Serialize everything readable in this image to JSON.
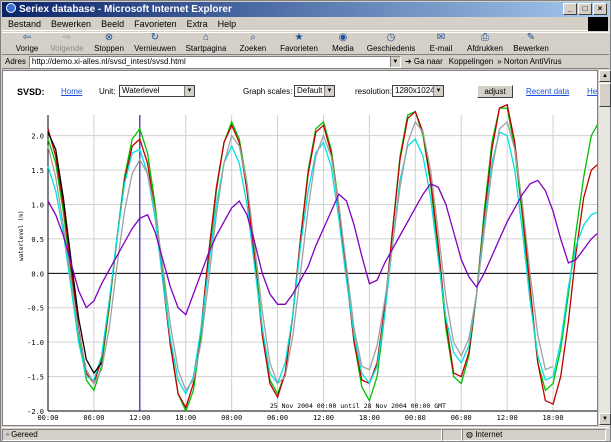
{
  "window": {
    "title": "Seriex database - Microsoft Internet Explorer"
  },
  "menubar": {
    "items": [
      "Bestand",
      "Bewerken",
      "Beeld",
      "Favorieten",
      "Extra",
      "Help"
    ]
  },
  "toolbar": {
    "buttons": [
      {
        "label": "Vorige",
        "icon": "back-arrow-icon",
        "enabled": true
      },
      {
        "label": "Volgende",
        "icon": "forward-arrow-icon",
        "enabled": false
      },
      {
        "label": "Stoppen",
        "icon": "stop-icon",
        "enabled": true
      },
      {
        "label": "Vernieuwen",
        "icon": "refresh-icon",
        "enabled": true
      },
      {
        "label": "Startpagina",
        "icon": "home-icon",
        "enabled": true
      },
      {
        "label": "Zoeken",
        "icon": "search-icon",
        "enabled": true
      },
      {
        "label": "Favorieten",
        "icon": "favorites-icon",
        "enabled": true
      },
      {
        "label": "Media",
        "icon": "media-icon",
        "enabled": true
      },
      {
        "label": "Geschiedenis",
        "icon": "history-icon",
        "enabled": true
      },
      {
        "label": "E-mail",
        "icon": "mail-icon",
        "enabled": true
      },
      {
        "label": "Afdrukken",
        "icon": "print-icon",
        "enabled": true
      },
      {
        "label": "Bewerken",
        "icon": "edit-icon",
        "enabled": true
      }
    ]
  },
  "address": {
    "label": "Adres",
    "url": "http://demo.xi-alles.nl/svsd_intest/svsd.html",
    "go_label": "Ga naar",
    "links_label": "Koppelingen",
    "extra_label": "Norton AntiVirus"
  },
  "page": {
    "svsd_label": "SVSD:",
    "home_link": "Home",
    "unit_label": "Unit:",
    "unit_value": "Waterlevel",
    "graph_scales_label": "Graph scales:",
    "graph_scales_value": "Default",
    "resolution_label": "resolution:",
    "resolution_value": "1280x1024",
    "adjust_button": "adjust",
    "recent_data_link": "Recent data",
    "help_link": "Help"
  },
  "statusbar": {
    "status_text": "Gereed",
    "zone_text": "Internet"
  },
  "chart_data": {
    "type": "line",
    "title": "",
    "ylabel": "waterlevel (m)",
    "xlabel": "",
    "annotation": "25 Nov 2004 00:00 until 28 Nov 2004 00:00 GMT",
    "ylim": [
      -2.0,
      2.3
    ],
    "yticks": [
      -2.0,
      -1.5,
      -1.0,
      -0.5,
      0.0,
      0.5,
      1.0,
      1.5,
      2.0
    ],
    "ytick_labels": [
      "-2.0",
      "-1.5",
      "-1.0",
      "-0.5",
      "0.0",
      "0.5",
      "1.0",
      "1.5",
      "2.0"
    ],
    "xlim_hours": [
      0,
      72
    ],
    "xticks_hours": [
      0,
      6,
      12,
      18,
      24,
      30,
      36,
      42,
      48,
      54,
      60,
      66
    ],
    "xtick_labels": [
      "00:00",
      "06:00",
      "12:00",
      "18:00",
      "00:00",
      "06:00",
      "12:00",
      "18:00",
      "00:00",
      "06:00",
      "12:00",
      "18:00"
    ],
    "marker_hour": 12,
    "grid": true,
    "series": [
      {
        "color": "#00c000",
        "x": [
          0,
          1,
          2,
          3,
          4,
          5,
          6,
          7,
          8,
          9,
          10,
          11,
          12,
          13,
          14,
          15,
          16,
          17,
          18,
          19,
          20,
          21,
          22,
          23,
          24,
          25,
          26,
          27,
          28,
          29,
          30,
          31,
          32,
          33,
          34,
          35,
          36,
          37,
          38,
          39,
          40,
          41,
          42,
          43,
          44,
          45,
          46,
          47,
          48,
          49,
          50,
          51,
          52,
          53,
          54,
          55,
          56,
          57,
          58,
          59,
          60,
          61,
          62,
          63,
          64,
          65,
          66,
          67,
          68,
          69,
          70,
          71,
          72
        ],
        "y": [
          1.95,
          1.6,
          0.9,
          0.0,
          -0.9,
          -1.55,
          -1.7,
          -1.35,
          -0.5,
          0.5,
          1.4,
          1.95,
          2.1,
          1.75,
          1.0,
          0.0,
          -1.0,
          -1.75,
          -2.0,
          -1.7,
          -0.9,
          0.2,
          1.2,
          1.9,
          2.2,
          1.95,
          1.3,
          0.3,
          -0.8,
          -1.55,
          -1.75,
          -1.45,
          -0.6,
          0.5,
          1.5,
          2.1,
          2.2,
          1.8,
          1.0,
          0.0,
          -1.0,
          -1.65,
          -1.85,
          -1.5,
          -0.6,
          0.6,
          1.7,
          2.3,
          2.35,
          2.0,
          1.3,
          0.3,
          -0.8,
          -1.5,
          -1.6,
          -1.2,
          -0.3,
          0.9,
          1.9,
          2.4,
          2.4,
          1.8,
          0.8,
          -0.3,
          -1.3,
          -1.7,
          -1.6,
          -1.1,
          -0.3,
          0.6,
          1.4,
          2.0,
          2.2
        ]
      },
      {
        "color": "#c00000",
        "x": [
          0,
          1,
          2,
          3,
          4,
          5,
          6,
          7,
          8,
          9,
          10,
          11,
          12,
          13,
          14,
          15,
          16,
          17,
          18,
          19,
          20,
          21,
          22,
          23,
          24,
          25,
          26,
          27,
          28,
          29,
          30,
          31,
          32,
          33,
          34,
          35,
          36,
          37,
          38,
          39,
          40,
          41,
          42,
          43,
          44,
          45,
          46,
          47,
          48,
          49,
          50,
          51,
          52,
          53,
          54,
          55,
          56,
          57,
          58,
          59,
          60,
          61,
          62,
          63,
          64,
          65,
          66,
          67,
          68,
          69,
          70,
          71,
          72
        ],
        "y": [
          2.1,
          1.7,
          1.0,
          0.1,
          -0.8,
          -1.45,
          -1.6,
          -1.25,
          -0.45,
          0.5,
          1.35,
          1.85,
          1.95,
          1.6,
          0.9,
          -0.1,
          -1.05,
          -1.75,
          -1.95,
          -1.6,
          -0.8,
          0.3,
          1.25,
          1.9,
          2.15,
          1.9,
          1.2,
          0.2,
          -0.9,
          -1.6,
          -1.8,
          -1.45,
          -0.6,
          0.5,
          1.45,
          2.05,
          2.15,
          1.75,
          0.95,
          -0.05,
          -1.0,
          -1.55,
          -1.6,
          -1.3,
          -0.5,
          0.6,
          1.65,
          2.25,
          2.35,
          2.05,
          1.35,
          0.4,
          -0.7,
          -1.45,
          -1.5,
          -1.15,
          -0.3,
          0.8,
          1.8,
          2.4,
          2.45,
          1.9,
          0.9,
          -0.2,
          -1.3,
          -1.85,
          -1.9,
          -1.5,
          -0.7,
          0.3,
          1.1,
          1.5,
          1.6
        ]
      },
      {
        "color": "#00e0e0",
        "x": [
          0,
          1,
          2,
          3,
          4,
          5,
          6,
          7,
          8,
          9,
          10,
          11,
          12,
          13,
          14,
          15,
          16,
          17,
          18,
          19,
          20,
          21,
          22,
          23,
          24,
          25,
          26,
          27,
          28,
          29,
          30,
          31,
          32,
          33,
          34,
          35,
          36,
          37,
          38,
          39,
          40,
          41,
          42,
          43,
          44,
          45,
          46,
          47,
          48,
          49,
          50,
          51,
          52,
          53,
          54,
          55,
          56,
          57,
          58,
          59,
          60,
          61,
          62,
          63,
          64,
          65,
          66,
          67,
          68,
          69,
          70,
          71,
          72
        ],
        "y": [
          1.55,
          1.2,
          0.6,
          -0.2,
          -1.0,
          -1.5,
          -1.55,
          -1.2,
          -0.4,
          0.5,
          1.3,
          1.75,
          1.8,
          1.45,
          0.8,
          -0.1,
          -0.95,
          -1.55,
          -1.75,
          -1.5,
          -0.8,
          0.1,
          1.0,
          1.6,
          1.85,
          1.6,
          1.0,
          0.1,
          -0.8,
          -1.45,
          -1.6,
          -1.3,
          -0.6,
          0.4,
          1.2,
          1.75,
          1.9,
          1.55,
          0.8,
          -0.1,
          -0.9,
          -1.45,
          -1.6,
          -1.35,
          -0.6,
          0.4,
          1.35,
          1.85,
          1.95,
          1.7,
          1.1,
          0.2,
          -0.65,
          -1.15,
          -1.3,
          -1.05,
          -0.3,
          0.7,
          1.6,
          2.05,
          2.0,
          1.5,
          0.6,
          -0.4,
          -1.2,
          -1.55,
          -1.5,
          -1.0,
          -0.2,
          0.4,
          0.7,
          0.85,
          0.9
        ]
      },
      {
        "color": "#a0a0a0",
        "x": [
          0,
          1,
          2,
          3,
          4,
          5,
          6,
          7,
          8,
          9,
          10,
          11,
          12,
          13,
          14,
          15,
          16,
          17,
          18,
          19,
          20,
          21,
          22,
          23,
          24,
          25,
          26,
          27,
          28,
          29,
          30,
          31,
          32,
          33,
          34,
          35,
          36,
          37,
          38,
          39,
          40,
          41,
          42,
          43,
          44,
          45,
          46,
          47,
          48,
          49,
          50,
          51,
          52,
          53,
          54,
          55,
          56,
          57,
          58,
          59,
          60,
          61,
          62,
          63,
          64,
          65,
          66
        ],
        "y": [
          1.85,
          1.4,
          0.7,
          -0.1,
          -0.85,
          -1.4,
          -1.6,
          -1.4,
          -0.8,
          0.1,
          0.9,
          1.45,
          1.65,
          1.45,
          0.9,
          0.1,
          -0.75,
          -1.4,
          -1.7,
          -1.55,
          -1.0,
          -0.1,
          0.85,
          1.6,
          2.0,
          1.85,
          1.3,
          0.4,
          -0.55,
          -1.3,
          -1.6,
          -1.5,
          -0.9,
          0.0,
          0.95,
          1.7,
          2.0,
          1.7,
          1.0,
          0.1,
          -0.8,
          -1.35,
          -1.4,
          -1.05,
          -0.4,
          0.4,
          1.25,
          1.9,
          2.2,
          2.05,
          1.5,
          0.6,
          -0.35,
          -1.0,
          -1.2,
          -0.95,
          -0.3,
          0.6,
          1.5,
          2.1,
          2.2,
          1.8,
          1.0,
          0.0,
          -0.9,
          -1.4,
          -1.35
        ]
      },
      {
        "color": "#000000",
        "x": [
          0,
          1,
          2,
          3,
          4,
          5,
          6,
          7
        ],
        "y": [
          2.05,
          1.8,
          1.1,
          0.2,
          -0.65,
          -1.25,
          -1.45,
          -1.3
        ]
      },
      {
        "color": "#8000c0",
        "x": [
          0,
          1,
          2,
          3,
          4,
          5,
          6,
          7,
          8,
          9,
          10,
          11,
          12,
          13,
          14,
          15,
          16,
          17,
          18,
          19,
          20,
          21,
          22,
          23,
          24,
          25,
          26,
          27,
          28,
          29,
          30,
          31,
          32,
          33,
          34,
          35,
          36,
          37,
          38,
          39,
          40,
          41,
          42,
          43,
          44,
          45,
          46,
          47,
          48,
          49,
          50,
          51,
          52,
          53,
          54,
          55,
          56,
          57,
          58,
          59,
          60,
          61,
          62,
          63,
          64,
          65,
          66,
          67,
          68,
          69,
          70,
          71,
          72
        ],
        "y": [
          1.05,
          0.85,
          0.55,
          0.15,
          -0.25,
          -0.5,
          -0.4,
          -0.15,
          0.05,
          0.25,
          0.45,
          0.65,
          0.8,
          0.85,
          0.6,
          0.2,
          -0.2,
          -0.5,
          -0.6,
          -0.3,
          0.0,
          0.3,
          0.55,
          0.75,
          0.95,
          1.05,
          0.85,
          0.45,
          0.0,
          -0.3,
          -0.45,
          -0.45,
          -0.3,
          -0.1,
          0.1,
          0.4,
          0.65,
          0.9,
          1.15,
          1.05,
          0.7,
          0.25,
          -0.15,
          -0.1,
          0.15,
          0.35,
          0.55,
          0.75,
          0.95,
          1.15,
          1.3,
          1.25,
          1.0,
          0.6,
          0.2,
          -0.05,
          -0.2,
          0.0,
          0.25,
          0.5,
          0.75,
          0.95,
          1.15,
          1.3,
          1.35,
          1.2,
          0.9,
          0.5,
          0.15,
          0.2,
          0.35,
          0.5,
          0.6
        ]
      }
    ]
  }
}
